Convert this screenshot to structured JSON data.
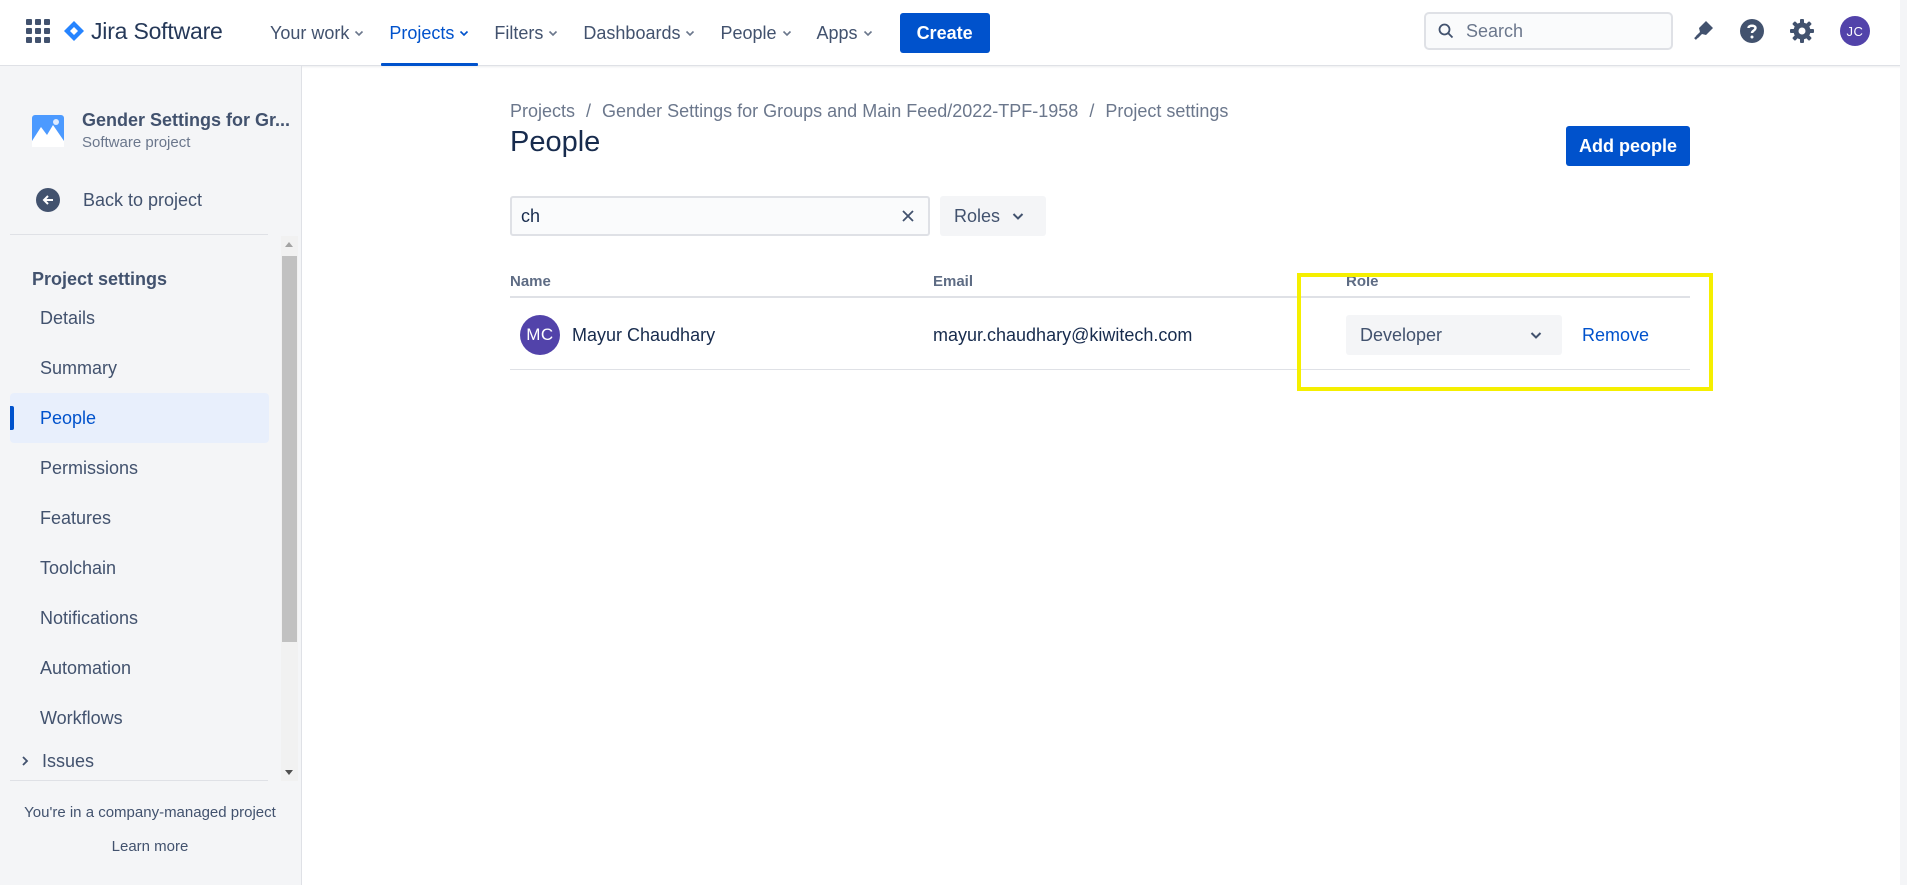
{
  "topnav": {
    "logo_text": "Jira Software",
    "items": [
      {
        "label": "Your work"
      },
      {
        "label": "Projects"
      },
      {
        "label": "Filters"
      },
      {
        "label": "Dashboards"
      },
      {
        "label": "People"
      },
      {
        "label": "Apps"
      }
    ],
    "active_item": "Projects",
    "create_label": "Create",
    "search_placeholder": "Search",
    "avatar_initials": "JC",
    "accent_color": "#0052cc"
  },
  "sidebar": {
    "project_name": "Gender Settings for Gr...",
    "project_type": "Software project",
    "back_label": "Back to project",
    "section_heading": "Project settings",
    "items": [
      {
        "label": "Details"
      },
      {
        "label": "Summary"
      },
      {
        "label": "People"
      },
      {
        "label": "Permissions"
      },
      {
        "label": "Features"
      },
      {
        "label": "Toolchain"
      },
      {
        "label": "Notifications"
      },
      {
        "label": "Automation"
      },
      {
        "label": "Workflows"
      },
      {
        "label": "Issues"
      }
    ],
    "active_item": "People",
    "footer_text": "You're in a company-managed project",
    "footer_link": "Learn more"
  },
  "main": {
    "breadcrumb": [
      "Projects",
      "Gender Settings for Groups and Main Feed/2022-TPF-1958",
      "Project settings"
    ],
    "title": "People",
    "add_people_label": "Add people",
    "filter_value": "ch",
    "roles_label": "Roles",
    "table": {
      "columns": [
        "Name",
        "Email",
        "Role"
      ],
      "rows": [
        {
          "initials": "MC",
          "name": "Mayur Chaudhary",
          "email": "mayur.chaudhary@kiwitech.com",
          "role": "Developer",
          "action": "Remove"
        }
      ]
    },
    "highlight_color": "#f5ef00"
  }
}
